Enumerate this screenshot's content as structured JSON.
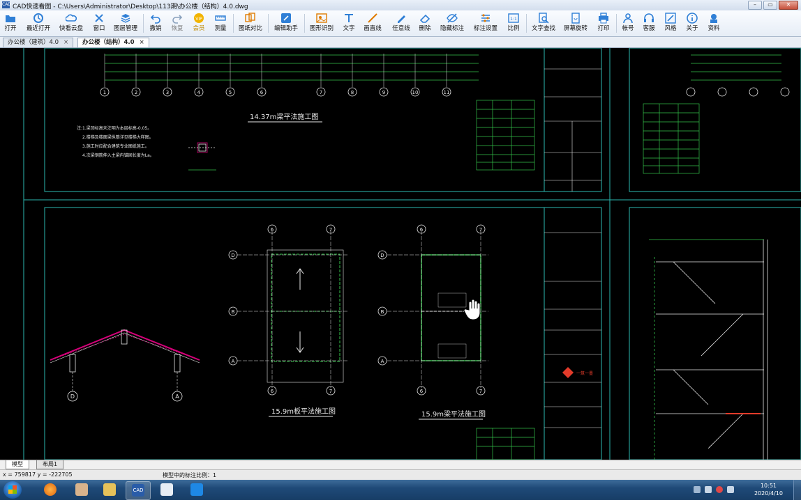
{
  "window": {
    "title": "CAD快速看图 - C:\\Users\\Administrator\\Desktop\\113期\\办公楼（结构）4.0.dwg"
  },
  "toolbar": {
    "items": [
      {
        "label": "打开",
        "icon": "folder-icon"
      },
      {
        "label": "最近打开",
        "icon": "recent-icon"
      },
      {
        "label": "快看云盘",
        "icon": "cloud-icon"
      },
      {
        "label": "窗口",
        "icon": "window-icon"
      },
      {
        "label": "图层管理",
        "icon": "layers-icon"
      },
      {
        "label": "撤销",
        "icon": "undo-icon"
      },
      {
        "label": "恢复",
        "icon": "redo-icon"
      },
      {
        "label": "会员",
        "icon": "vip-icon"
      },
      {
        "label": "测量",
        "icon": "measure-icon"
      },
      {
        "label": "图纸对比",
        "icon": "compare-icon"
      },
      {
        "label": "编辑助手",
        "icon": "edit-assistant-icon"
      },
      {
        "label": "图形识别",
        "icon": "shape-recognize-icon"
      },
      {
        "label": "文字",
        "icon": "text-icon"
      },
      {
        "label": "画直线",
        "icon": "line-icon"
      },
      {
        "label": "任意线",
        "icon": "freehand-icon"
      },
      {
        "label": "删除",
        "icon": "eraser-icon"
      },
      {
        "label": "隐藏标注",
        "icon": "hide-annotation-icon"
      },
      {
        "label": "标注设置",
        "icon": "annotation-settings-icon"
      },
      {
        "label": "比例",
        "icon": "scale-icon"
      },
      {
        "label": "文字查找",
        "icon": "text-search-icon"
      },
      {
        "label": "屏幕旋转",
        "icon": "rotate-screen-icon"
      },
      {
        "label": "打印",
        "icon": "print-icon"
      },
      {
        "label": "帐号",
        "icon": "account-icon"
      },
      {
        "label": "客服",
        "icon": "headset-icon"
      },
      {
        "label": "风格",
        "icon": "style-icon"
      },
      {
        "label": "关于",
        "icon": "info-icon"
      },
      {
        "label": "资料",
        "icon": "docs-icon"
      }
    ]
  },
  "tabs": [
    {
      "label": "办公楼（建筑）4.0",
      "close": "×",
      "active": false
    },
    {
      "label": "办公楼（结构）4.0",
      "close": "×",
      "active": true
    }
  ],
  "drawing": {
    "roof_title": "14.37m梁平法施工图",
    "slab_title": "15.9m板平法施工图",
    "beam_title": "15.9m梁平法施工图",
    "notes": [
      "注:1.梁顶标高未注明为本层标高-0.05。",
      "2.楼梯及楼面梁纵筋详见楼梯大样图。",
      "3.施工时应配合建筑专业图纸施工。",
      "4.次梁钢筋伸入主梁内锚固长度为La。"
    ],
    "axes_top": [
      "1",
      "2",
      "3",
      "4",
      "5",
      "6",
      "7",
      "8",
      "9",
      "10",
      "11"
    ],
    "axes_mid_slab": [
      "6",
      "7"
    ],
    "rows_slab": [
      "D",
      "B",
      "A"
    ],
    "section_left_labels": [
      "D",
      "A"
    ],
    "logo_text": "一筑一墨",
    "colors": {
      "lines": "#2db7b0",
      "green": "#34c34a",
      "white": "#e8e8e8",
      "magenta": "#d6007a",
      "red": "#e23b2a"
    }
  },
  "layout_tabs": [
    {
      "label": "模型",
      "active": true
    },
    {
      "label": "布局1",
      "active": false
    }
  ],
  "status": {
    "coords": "x = 759817 y = -222705",
    "message": "模型中的标注比例：1"
  },
  "taskbar": {
    "apps": [
      "browser-icon",
      "user-icon",
      "explorer-icon",
      "cad-icon",
      "remote-icon",
      "teamviewer-icon"
    ],
    "cad_label": "CAD",
    "time": "10:51",
    "date": "2020/4/10"
  }
}
